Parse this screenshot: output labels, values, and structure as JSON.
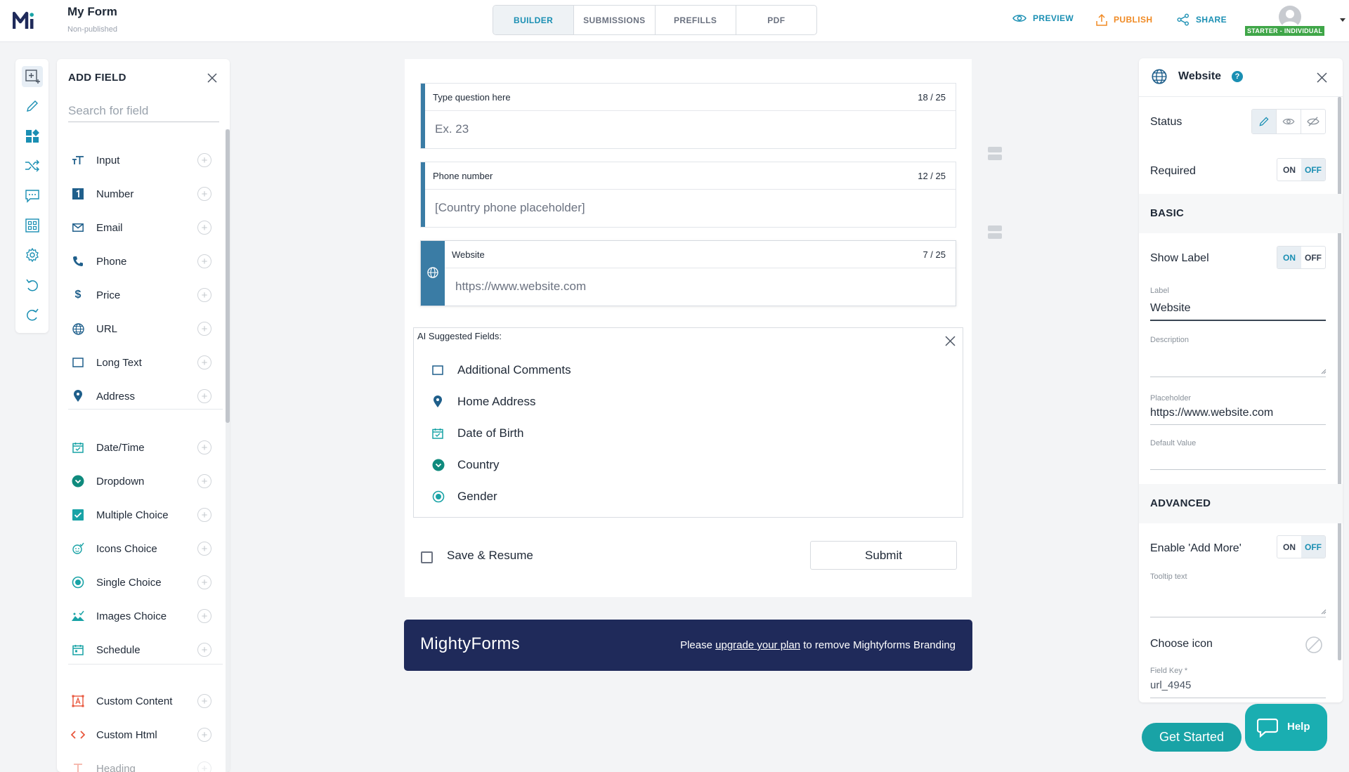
{
  "header": {
    "title": "My Form",
    "subtitle": "Non-published",
    "tabs": [
      "BUILDER",
      "SUBMISSIONS",
      "PREFILLS",
      "PDF"
    ],
    "active_tab": "BUILDER",
    "actions": {
      "preview": "PREVIEW",
      "publish": "PUBLISH",
      "share": "SHARE"
    },
    "plan_badge": "STARTER - INDIVIDUAL"
  },
  "toolbar": {
    "items": [
      "add-field-icon",
      "pencil-icon",
      "widgets-icon",
      "shuffle-icon",
      "chat-icon",
      "grid-icon",
      "gear-icon",
      "undo-icon",
      "redo-icon"
    ]
  },
  "add_field": {
    "title": "ADD FIELD",
    "search_placeholder": "Search for field",
    "group1": [
      {
        "label": "Input",
        "icon": "text-size-icon"
      },
      {
        "label": "Number",
        "icon": "number-one-icon"
      },
      {
        "label": "Email",
        "icon": "envelope-icon"
      },
      {
        "label": "Phone",
        "icon": "phone-icon"
      },
      {
        "label": "Price",
        "icon": "dollar-icon"
      },
      {
        "label": "URL",
        "icon": "globe-icon"
      },
      {
        "label": "Long Text",
        "icon": "textarea-icon"
      },
      {
        "label": "Address",
        "icon": "map-pin-icon"
      }
    ],
    "group2": [
      {
        "label": "Date/Time",
        "icon": "calendar-icon"
      },
      {
        "label": "Dropdown",
        "icon": "dropdown-icon"
      },
      {
        "label": "Multiple Choice",
        "icon": "checkbox-icon"
      },
      {
        "label": "Icons Choice",
        "icon": "icons-choice-icon"
      },
      {
        "label": "Single Choice",
        "icon": "radio-icon"
      },
      {
        "label": "Images Choice",
        "icon": "image-icon"
      },
      {
        "label": "Schedule",
        "icon": "schedule-icon"
      }
    ],
    "group3": [
      {
        "label": "Custom Content",
        "icon": "custom-content-icon"
      },
      {
        "label": "Custom Html",
        "icon": "code-icon"
      },
      {
        "label": "Heading",
        "icon": "heading-icon"
      }
    ]
  },
  "form": {
    "fields": [
      {
        "label": "Type question here",
        "count": "18 / 25",
        "placeholder": "Ex. 23"
      },
      {
        "label": "Phone number",
        "count": "12 / 25",
        "placeholder": "[Country phone placeholder]"
      },
      {
        "label": "Website",
        "count": "7 / 25",
        "placeholder": "https://www.website.com"
      }
    ],
    "ai_suggested": {
      "title": "AI Suggested Fields:",
      "items": [
        {
          "label": "Additional Comments",
          "icon": "textarea-icon"
        },
        {
          "label": "Home Address",
          "icon": "map-pin-icon"
        },
        {
          "label": "Date of Birth",
          "icon": "calendar-icon"
        },
        {
          "label": "Country",
          "icon": "dropdown-icon"
        },
        {
          "label": "Gender",
          "icon": "radio-icon"
        }
      ]
    },
    "save_resume": "Save & Resume",
    "submit": "Submit"
  },
  "branding": {
    "logo": "MightyForms",
    "msg_before": "Please ",
    "msg_link": "upgrade your plan",
    "msg_after": " to remove Mightyforms Branding"
  },
  "settings": {
    "title": "Website",
    "help": "?",
    "status_label": "Status",
    "required_label": "Required",
    "required": {
      "on": "ON",
      "off": "OFF",
      "selected": "OFF"
    },
    "basic": "BASIC",
    "show_label": "Show Label",
    "show_label_toggle": {
      "on": "ON",
      "off": "OFF",
      "selected": "ON"
    },
    "label_caption": "Label",
    "label_value": "Website",
    "description_caption": "Description",
    "placeholder_caption": "Placeholder",
    "placeholder_value": "https://www.website.com",
    "default_caption": "Default Value",
    "advanced": "ADVANCED",
    "add_more_label": "Enable 'Add More'",
    "add_more": {
      "on": "ON",
      "off": "OFF",
      "selected": "OFF"
    },
    "tooltip_caption": "Tooltip text",
    "choose_icon": "Choose icon",
    "field_key_caption": "Field Key *",
    "field_key_value": "url_4945"
  },
  "footer_buttons": {
    "get_started": "Get Started",
    "help": "Help"
  },
  "colors": {
    "accent": "#1a8fb3",
    "field_bar": "#3a7ca5",
    "brand_bg": "#1f2a5a",
    "teal": "#19a3a6",
    "badge_green": "#3fa648"
  }
}
